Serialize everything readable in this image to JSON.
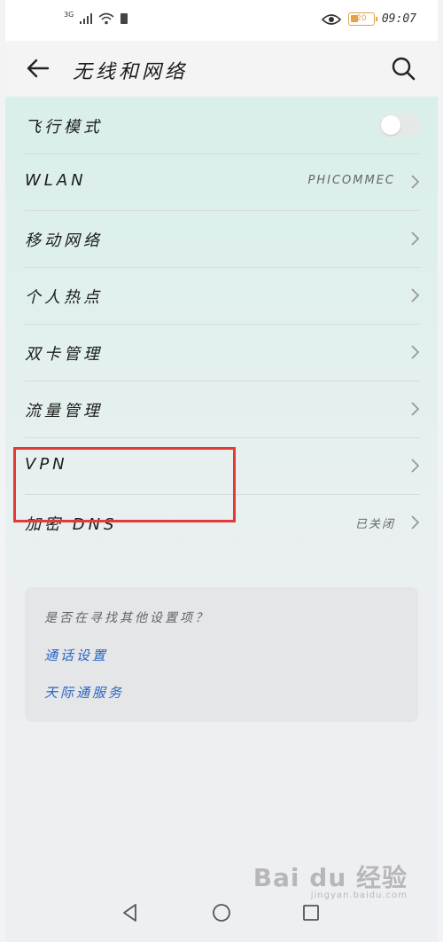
{
  "status_bar": {
    "network": "3G",
    "battery": "20",
    "time": "09:07"
  },
  "header": {
    "title": "无线和网络"
  },
  "settings": [
    {
      "label": "飞行模式",
      "type": "toggle",
      "on": false
    },
    {
      "label": "WLAN",
      "type": "link",
      "value": "PHICOMMEC"
    },
    {
      "label": "移动网络",
      "type": "link",
      "value": ""
    },
    {
      "label": "个人热点",
      "type": "link",
      "value": ""
    },
    {
      "label": "双卡管理",
      "type": "link",
      "value": ""
    },
    {
      "label": "流量管理",
      "type": "link",
      "value": ""
    },
    {
      "label": "VPN",
      "type": "link",
      "value": ""
    },
    {
      "label": "加密 DNS",
      "type": "link",
      "value": "已关闭"
    }
  ],
  "suggestions": {
    "title": "是否在寻找其他设置项？",
    "links": [
      "通话设置",
      "天际通服务"
    ]
  },
  "watermark": {
    "brand": "Bai du 经验",
    "site": "jingyan.baidu.com"
  },
  "colors": {
    "link": "#2b66c4",
    "highlight": "#e53935"
  }
}
